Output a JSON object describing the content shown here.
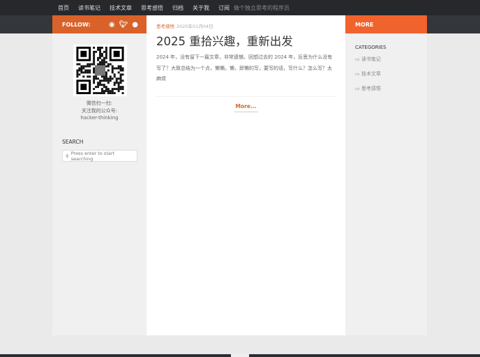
{
  "nav": {
    "items": [
      "首页",
      "读书笔记",
      "技术文章",
      "思考感悟",
      "归档",
      "关于我",
      "订阅"
    ],
    "tagline": "做个独立思考的程序员"
  },
  "left": {
    "follow": "FOLLOW:",
    "icons": [
      "weibo-icon",
      "twitter-icon",
      "github-icon"
    ],
    "qr_lines": [
      "微信扫一扫:",
      "关注我的公众号:",
      "hacker-thinking"
    ],
    "search_title": "SEARCH",
    "search_placeholder": "Press enter to start searching"
  },
  "post": {
    "category": "思考感悟",
    "date": "2025年01月04日",
    "title": "2025 重拾兴趣，重新出发",
    "excerpt": "2024 年，没有留下一篇文章，非常遗憾。回想过去的 2024 年，反思为什么没有写了？大致总结为一个点，懒懒。懒，即懒的写，要写的话，写什么？怎么写？太麻烦",
    "more": "More..."
  },
  "right": {
    "title": "MORE",
    "categories_title": "CATEGORIES",
    "categories": [
      "读书笔记",
      "技术文章",
      "思考感悟"
    ]
  },
  "colors": {
    "accent": "#d9622b",
    "accent_right": "#f0632c",
    "nav_bg": "#26282c"
  }
}
